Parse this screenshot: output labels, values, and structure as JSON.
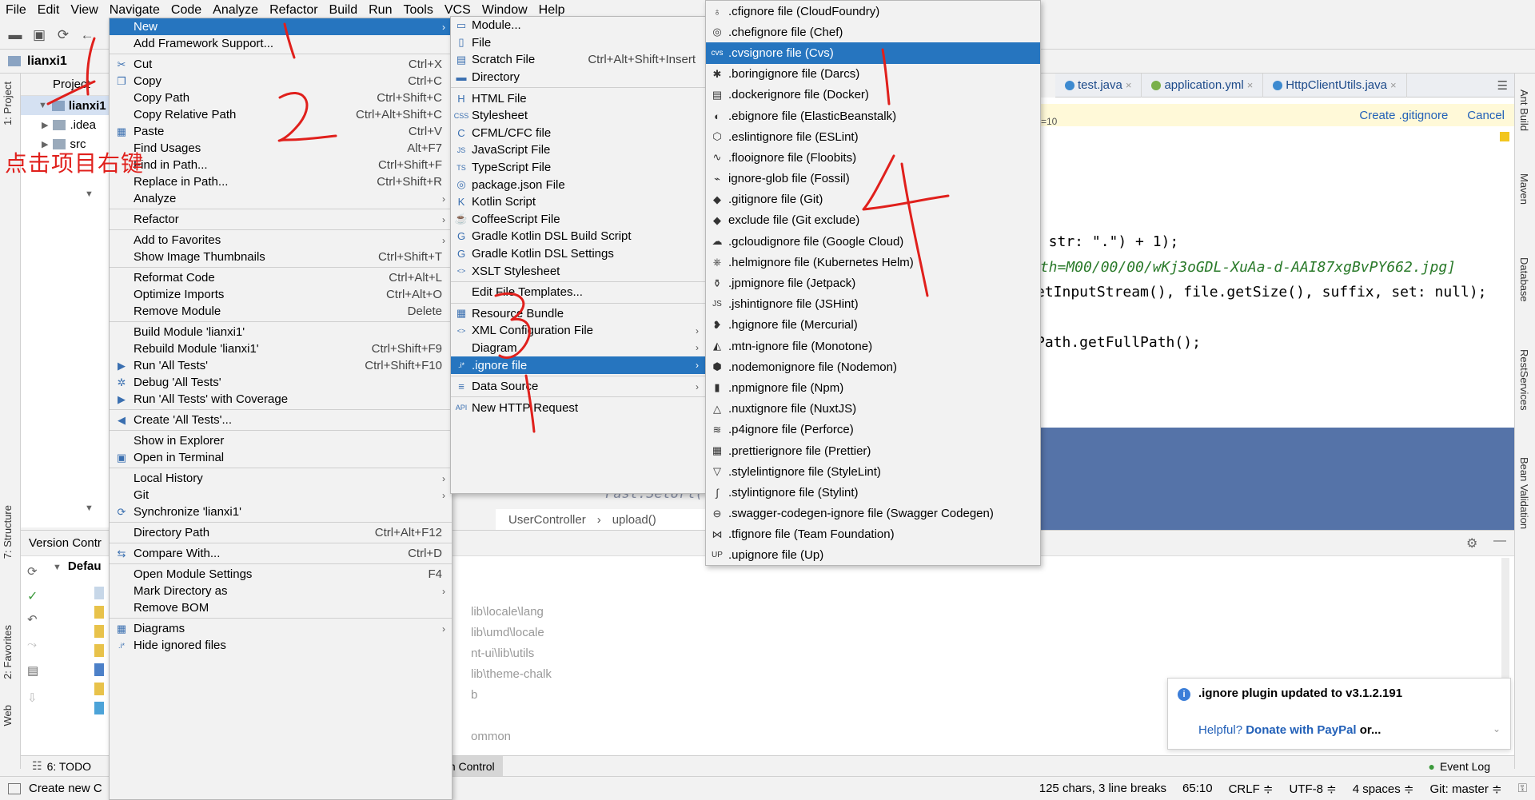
{
  "menubar": {
    "items": [
      "File",
      "Edit",
      "View",
      "Navigate",
      "Code",
      "Analyze",
      "Refactor",
      "Build",
      "Run",
      "Tools",
      "VCS",
      "Window",
      "Help"
    ]
  },
  "navbar": {
    "project": "lianxi1"
  },
  "left_stripe": {
    "project_tab": "1: Project",
    "structure_tab": "7: Structure",
    "favorites_tab": "2: Favorites",
    "web_tab": "Web"
  },
  "right_stripe": {
    "ant_tab": "Ant Build",
    "maven_tab": "Maven",
    "database_tab": "Database",
    "rest_tab": "RestServices",
    "bean_tab": "Bean Validation"
  },
  "project_panel": {
    "header": "Project",
    "root": "lianxi1",
    "child1": ".idea",
    "child2": "src"
  },
  "annotation_text": "点击项目右键",
  "context_menu": {
    "items": [
      {
        "label": "New",
        "shortcut": "",
        "submenu": true,
        "selected": true,
        "icon": ""
      },
      {
        "label": "Add Framework Support...",
        "shortcut": "",
        "icon": ""
      },
      {
        "sep": true
      },
      {
        "label": "Cut",
        "shortcut": "Ctrl+X",
        "icon": "scissors-icon"
      },
      {
        "label": "Copy",
        "shortcut": "Ctrl+C",
        "icon": "copy-icon"
      },
      {
        "label": "Copy Path",
        "shortcut": "Ctrl+Shift+C",
        "icon": ""
      },
      {
        "label": "Copy Relative Path",
        "shortcut": "Ctrl+Alt+Shift+C",
        "icon": ""
      },
      {
        "label": "Paste",
        "shortcut": "Ctrl+V",
        "icon": "paste-icon"
      },
      {
        "label": "Find Usages",
        "shortcut": "Alt+F7",
        "icon": ""
      },
      {
        "label": "Find in Path...",
        "shortcut": "Ctrl+Shift+F",
        "icon": ""
      },
      {
        "label": "Replace in Path...",
        "shortcut": "Ctrl+Shift+R",
        "icon": ""
      },
      {
        "label": "Analyze",
        "shortcut": "",
        "submenu": true,
        "icon": ""
      },
      {
        "sep": true
      },
      {
        "label": "Refactor",
        "shortcut": "",
        "submenu": true,
        "icon": ""
      },
      {
        "sep": true
      },
      {
        "label": "Add to Favorites",
        "shortcut": "",
        "submenu": true,
        "icon": ""
      },
      {
        "label": "Show Image Thumbnails",
        "shortcut": "Ctrl+Shift+T",
        "icon": ""
      },
      {
        "sep": true
      },
      {
        "label": "Reformat Code",
        "shortcut": "Ctrl+Alt+L",
        "icon": ""
      },
      {
        "label": "Optimize Imports",
        "shortcut": "Ctrl+Alt+O",
        "icon": ""
      },
      {
        "label": "Remove Module",
        "shortcut": "Delete",
        "icon": ""
      },
      {
        "sep": true
      },
      {
        "label": "Build Module 'lianxi1'",
        "shortcut": "",
        "icon": ""
      },
      {
        "label": "Rebuild Module 'lianxi1'",
        "shortcut": "Ctrl+Shift+F9",
        "icon": ""
      },
      {
        "label": "Run 'All Tests'",
        "shortcut": "Ctrl+Shift+F10",
        "icon": "run-icon"
      },
      {
        "label": "Debug 'All Tests'",
        "shortcut": "",
        "icon": "debug-icon"
      },
      {
        "label": "Run 'All Tests' with Coverage",
        "shortcut": "",
        "icon": "coverage-icon"
      },
      {
        "sep": true
      },
      {
        "label": "Create 'All Tests'...",
        "shortcut": "",
        "icon": "create-test-icon"
      },
      {
        "sep": true
      },
      {
        "label": "Show in Explorer",
        "shortcut": "",
        "icon": ""
      },
      {
        "label": "Open in Terminal",
        "shortcut": "",
        "icon": "terminal-icon"
      },
      {
        "sep": true
      },
      {
        "label": "Local History",
        "shortcut": "",
        "submenu": true,
        "icon": ""
      },
      {
        "label": "Git",
        "shortcut": "",
        "submenu": true,
        "icon": ""
      },
      {
        "label": "Synchronize 'lianxi1'",
        "shortcut": "",
        "icon": "sync-icon"
      },
      {
        "sep": true
      },
      {
        "label": "Directory Path",
        "shortcut": "Ctrl+Alt+F12",
        "icon": ""
      },
      {
        "sep": true
      },
      {
        "label": "Compare With...",
        "shortcut": "Ctrl+D",
        "icon": "compare-icon"
      },
      {
        "sep": true
      },
      {
        "label": "Open Module Settings",
        "shortcut": "F4",
        "icon": ""
      },
      {
        "label": "Mark Directory as",
        "shortcut": "",
        "submenu": true,
        "icon": ""
      },
      {
        "label": "Remove BOM",
        "shortcut": "",
        "icon": ""
      },
      {
        "sep": true
      },
      {
        "label": "Diagrams",
        "shortcut": "",
        "submenu": true,
        "icon": "diagram-icon"
      },
      {
        "label": "Hide ignored files",
        "shortcut": "",
        "icon": "ignore-icon"
      }
    ]
  },
  "new_menu": {
    "items": [
      {
        "label": "Module...",
        "shortcut": "",
        "icon": "module-icon"
      },
      {
        "label": "File",
        "shortcut": "",
        "icon": "file-icon"
      },
      {
        "label": "Scratch File",
        "shortcut": "Ctrl+Alt+Shift+Insert",
        "icon": "scratch-icon"
      },
      {
        "label": "Directory",
        "shortcut": "",
        "icon": "folder-icon"
      },
      {
        "sep": true
      },
      {
        "label": "HTML File",
        "shortcut": "",
        "icon": "html-icon"
      },
      {
        "label": "Stylesheet",
        "shortcut": "",
        "icon": "css-icon"
      },
      {
        "label": "CFML/CFC file",
        "shortcut": "",
        "icon": "cfml-icon"
      },
      {
        "label": "JavaScript File",
        "shortcut": "",
        "icon": "js-icon"
      },
      {
        "label": "TypeScript File",
        "shortcut": "",
        "icon": "ts-icon"
      },
      {
        "label": "package.json File",
        "shortcut": "",
        "icon": "package-icon"
      },
      {
        "label": "Kotlin Script",
        "shortcut": "",
        "icon": "kotlin-icon"
      },
      {
        "label": "CoffeeScript File",
        "shortcut": "",
        "icon": "coffee-icon"
      },
      {
        "label": "Gradle Kotlin DSL Build Script",
        "shortcut": "",
        "icon": "gradle-icon"
      },
      {
        "label": "Gradle Kotlin DSL Settings",
        "shortcut": "",
        "icon": "gradle-icon"
      },
      {
        "label": "XSLT Stylesheet",
        "shortcut": "",
        "icon": "xslt-icon"
      },
      {
        "sep": true
      },
      {
        "label": "Edit File Templates...",
        "shortcut": "",
        "icon": ""
      },
      {
        "sep": true
      },
      {
        "label": "Resource Bundle",
        "shortcut": "",
        "icon": "bundle-icon"
      },
      {
        "label": "XML Configuration File",
        "shortcut": "",
        "submenu": true,
        "icon": "xml-icon"
      },
      {
        "label": "Diagram",
        "shortcut": "",
        "submenu": true,
        "icon": ""
      },
      {
        "label": ".ignore file",
        "shortcut": "",
        "submenu": true,
        "selected": true,
        "icon": "ignore-icon"
      },
      {
        "sep": true
      },
      {
        "label": "Data Source",
        "shortcut": "",
        "submenu": true,
        "icon": "datasource-icon"
      },
      {
        "sep": true
      },
      {
        "label": "New HTTP Request",
        "shortcut": "",
        "icon": "api-icon"
      }
    ]
  },
  "ignore_menu": {
    "items": [
      {
        "label": ".cfignore file (CloudFoundry)",
        "icon": "cloudfoundry-icon",
        "glyph": "♁"
      },
      {
        "label": ".chefignore file (Chef)",
        "icon": "chef-icon",
        "glyph": "◎"
      },
      {
        "label": ".cvsignore file (Cvs)",
        "icon": "cvs-icon",
        "glyph": "cvs",
        "selected": true
      },
      {
        "label": ".boringignore file (Darcs)",
        "icon": "darcs-icon",
        "glyph": "✱"
      },
      {
        "label": ".dockerignore file (Docker)",
        "icon": "docker-icon",
        "glyph": "▤"
      },
      {
        "label": ".ebignore file (ElasticBeanstalk)",
        "icon": "beanstalk-icon",
        "glyph": "◐"
      },
      {
        "label": ".eslintignore file (ESLint)",
        "icon": "eslint-icon",
        "glyph": "⬡"
      },
      {
        "label": ".flooignore file (Floobits)",
        "icon": "floobits-icon",
        "glyph": "∿"
      },
      {
        "label": "ignore-glob file (Fossil)",
        "icon": "fossil-icon",
        "glyph": "⌁"
      },
      {
        "label": ".gitignore file (Git)",
        "icon": "git-icon",
        "glyph": "◆"
      },
      {
        "label": "exclude file (Git exclude)",
        "icon": "git-exclude-icon",
        "glyph": "◆"
      },
      {
        "label": ".gcloudignore file (Google Cloud)",
        "icon": "gcloud-icon",
        "glyph": "☁"
      },
      {
        "label": ".helmignore file (Kubernetes Helm)",
        "icon": "helm-icon",
        "glyph": "⎈"
      },
      {
        "label": ".jpmignore file (Jetpack)",
        "icon": "jetpack-icon",
        "glyph": "⚱"
      },
      {
        "label": ".jshintignore file (JSHint)",
        "icon": "jshint-icon",
        "glyph": "JS"
      },
      {
        "label": ".hgignore file (Mercurial)",
        "icon": "mercurial-icon",
        "glyph": "❥"
      },
      {
        "label": ".mtn-ignore file (Monotone)",
        "icon": "monotone-icon",
        "glyph": "◭"
      },
      {
        "label": ".nodemonignore file (Nodemon)",
        "icon": "nodemon-icon",
        "glyph": "⬢"
      },
      {
        "label": ".npmignore file (Npm)",
        "icon": "npm-icon",
        "glyph": "▮"
      },
      {
        "label": ".nuxtignore file (NuxtJS)",
        "icon": "nuxt-icon",
        "glyph": "△"
      },
      {
        "label": ".p4ignore file (Perforce)",
        "icon": "perforce-icon",
        "glyph": "≋"
      },
      {
        "label": ".prettierignore file (Prettier)",
        "icon": "prettier-icon",
        "glyph": "▦"
      },
      {
        "label": ".stylelintignore file (StyleLint)",
        "icon": "stylelint-icon",
        "glyph": "▽"
      },
      {
        "label": ".stylintignore file (Stylint)",
        "icon": "stylint-icon",
        "glyph": "∫"
      },
      {
        "label": ".swagger-codegen-ignore file (Swagger Codegen)",
        "icon": "swagger-icon",
        "glyph": "⊖"
      },
      {
        "label": ".tfignore file (Team Foundation)",
        "icon": "tfs-icon",
        "glyph": "⋈"
      },
      {
        "label": ".upignore file (Up)",
        "icon": "up-icon",
        "glyph": "UP"
      }
    ]
  },
  "editor": {
    "tabs": [
      {
        "label": "test.java"
      },
      {
        "label": "application.yml"
      },
      {
        "label": "HttpClientUtils.java"
      }
    ],
    "gitignore_create": "Create .gitignore",
    "gitignore_cancel": "Cancel",
    "code_line1": "( str: \".\") + 1);",
    "code_line2": "ath=M00/00/00/wKj3oGDL-XuAa-d-AAI87xgBvPY662.jpg]",
    "code_line3": "etInputStream(), file.getSize(), suffix,  set: null);",
    "code_line4": "Path.getFullPath();",
    "code_line5": "Fast.SetUrl(v1",
    "side_text": "=10"
  },
  "breadcrumbs": [
    "UserController",
    "upload()"
  ],
  "vc_panel": {
    "header": "Version Contr",
    "group": "Defau",
    "paths": [
      "lib\\locale\\lang",
      "lib\\umd\\locale",
      "nt-ui\\lib\\utils",
      "lib\\theme-chalk",
      "b",
      "ommon"
    ]
  },
  "tool_tabs": {
    "todo": "6: TODO",
    "vc": "on Control",
    "event_log": "Event Log"
  },
  "notification": {
    "title": ".ignore plugin updated to v3.1.2.191",
    "helpful": "Helpful?",
    "donate": "Donate with PayPal",
    "or": "or..."
  },
  "statusbar": {
    "left": "Create new C",
    "chars": "125 chars, 3 line breaks",
    "pos": "65:10",
    "crlf": "CRLF ≑",
    "encoding": "UTF-8 ≑",
    "indent": "4 spaces ≑",
    "git": "Git: master ≑"
  },
  "colors": {
    "selection": "#2675bf",
    "menu_bg": "#f2f2f2",
    "annotation": "#e0201c",
    "link": "#2260b8"
  }
}
